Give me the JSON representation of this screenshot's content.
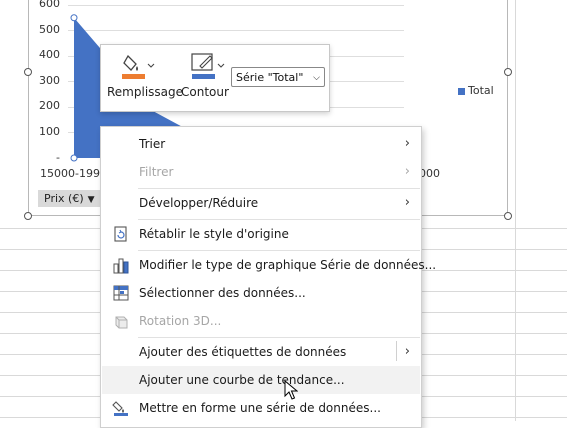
{
  "chart": {
    "y_ticks": [
      "600",
      "500",
      "400",
      "300",
      "200",
      "100",
      "-"
    ],
    "x_labels": [
      "15000-1999",
      "000"
    ],
    "legend": "Total",
    "field_button": "Prix (€)"
  },
  "chart_data": {
    "type": "area",
    "series": [
      {
        "name": "Total",
        "values": [
          550,
          180,
          0
        ]
      }
    ],
    "ylim": [
      0,
      600
    ],
    "legend_position": "right"
  },
  "colors": {
    "series": "#4472c4",
    "fill_accent": "#ed7d31"
  },
  "mini_toolbar": {
    "fill_label": "Remplissage",
    "outline_label": "Contour",
    "series_select": "Série \"Total\""
  },
  "menu": {
    "items": [
      {
        "label": "Trier",
        "icon": "",
        "disabled": false,
        "submenu": true
      },
      {
        "label": "Filtrer",
        "icon": "",
        "disabled": true,
        "submenu": true
      },
      {
        "label": "Développer/Réduire",
        "icon": "",
        "disabled": false,
        "submenu": true
      },
      {
        "label": "Rétablir le style d'origine",
        "icon": "reset-style-icon",
        "disabled": false,
        "submenu": false
      },
      {
        "label": "Modifier le type de graphique Série de données...",
        "icon": "chart-type-icon",
        "disabled": false,
        "submenu": false
      },
      {
        "label": "Sélectionner des données...",
        "icon": "select-data-icon",
        "disabled": false,
        "submenu": false
      },
      {
        "label": "Rotation 3D...",
        "icon": "rotation-3d-icon",
        "disabled": true,
        "submenu": false
      },
      {
        "label": "Ajouter des étiquettes de données",
        "icon": "",
        "disabled": false,
        "submenu": true
      },
      {
        "label": "Ajouter une courbe de tendance...",
        "icon": "",
        "disabled": false,
        "submenu": false,
        "highlighted": true
      },
      {
        "label": "Mettre en forme une série de données...",
        "icon": "format-series-icon",
        "disabled": false,
        "submenu": false
      }
    ]
  }
}
